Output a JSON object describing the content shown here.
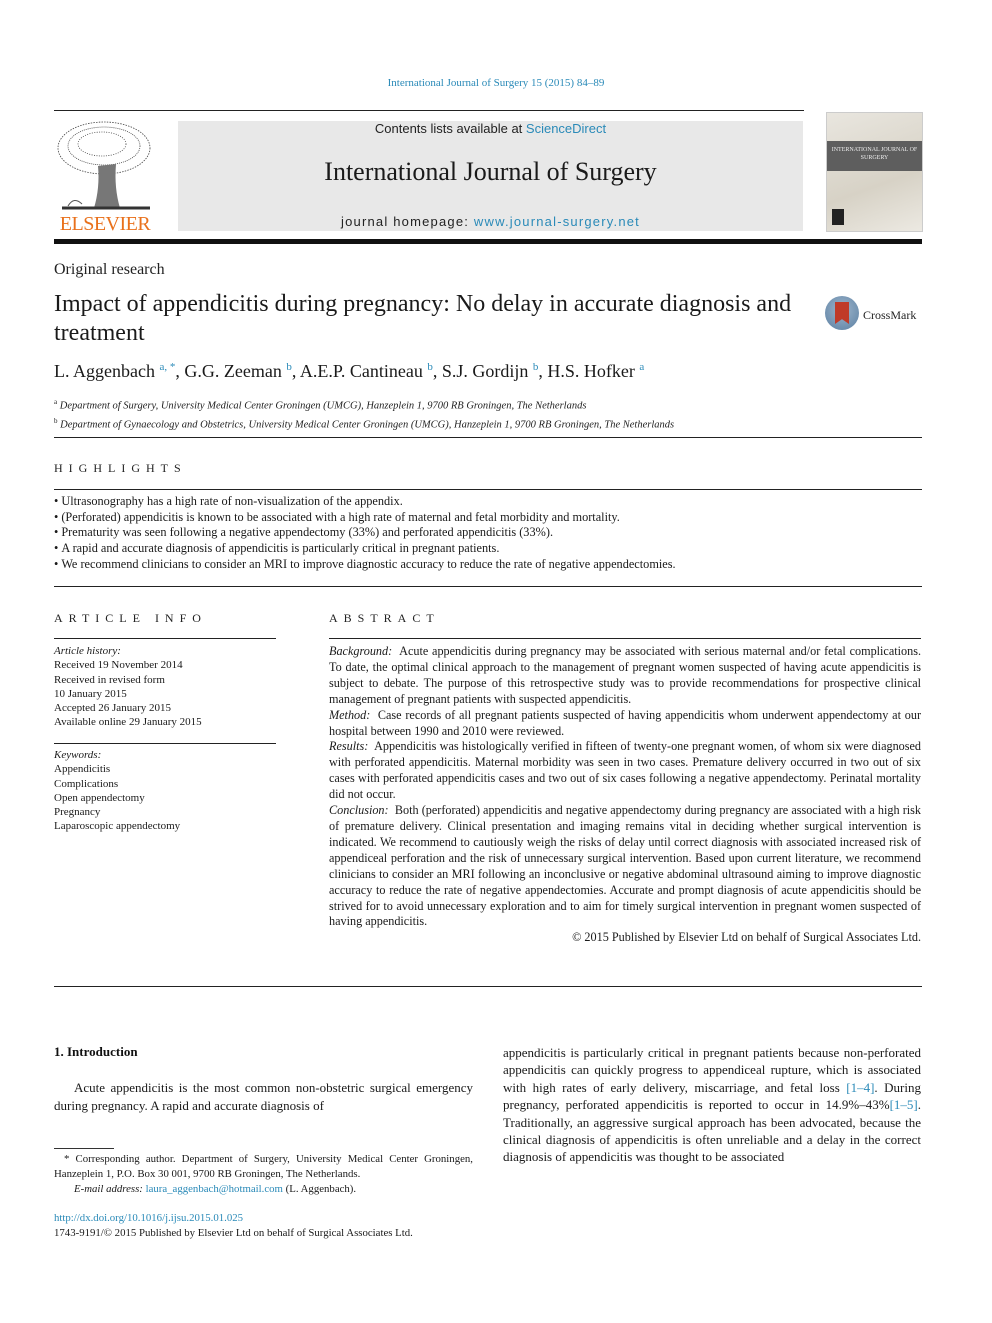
{
  "header": {
    "citation": "International Journal of Surgery 15 (2015) 84–89",
    "publisher_logo_text": "ELSEVIER",
    "contents_prefix": "Contents lists available at ",
    "contents_link": "ScienceDirect",
    "journal_title": "International Journal of Surgery",
    "homepage_prefix": "journal homepage: ",
    "homepage_link": "www.journal-surgery.net",
    "cover_title": "INTERNATIONAL JOURNAL OF SURGERY",
    "crossmark_label": "CrossMark"
  },
  "article": {
    "type": "Original research",
    "title": "Impact of appendicitis during pregnancy: No delay in accurate diagnosis and treatment",
    "authors": [
      {
        "name": "L. Aggenbach",
        "sup": "a, *"
      },
      {
        "name": "G.G. Zeeman",
        "sup": "b"
      },
      {
        "name": "A.E.P. Cantineau",
        "sup": "b"
      },
      {
        "name": "S.J. Gordijn",
        "sup": "b"
      },
      {
        "name": "H.S. Hofker",
        "sup": "a"
      }
    ],
    "affiliations": [
      {
        "key": "a",
        "text": "Department of Surgery, University Medical Center Groningen (UMCG), Hanzeplein 1, 9700 RB Groningen, The Netherlands"
      },
      {
        "key": "b",
        "text": "Department of Gynaecology and Obstetrics, University Medical Center Groningen (UMCG), Hanzeplein 1, 9700 RB Groningen, The Netherlands"
      }
    ]
  },
  "highlights": {
    "heading": "HIGHLIGHTS",
    "items": [
      "Ultrasonography has a high rate of non-visualization of the appendix.",
      "(Perforated) appendicitis is known to be associated with a high rate of maternal and fetal morbidity and mortality.",
      "Prematurity was seen following a negative appendectomy (33%) and perforated appendicitis (33%).",
      "A rapid and accurate diagnosis of appendicitis is particularly critical in pregnant patients.",
      "We recommend clinicians to consider an MRI to improve diagnostic accuracy to reduce the rate of negative appendectomies."
    ]
  },
  "article_info": {
    "heading": "ARTICLE INFO",
    "history_label": "Article history:",
    "history": [
      "Received 19 November 2014",
      "Received in revised form",
      "10 January 2015",
      "Accepted 26 January 2015",
      "Available online 29 January 2015"
    ],
    "keywords_label": "Keywords:",
    "keywords": [
      "Appendicitis",
      "Complications",
      "Open appendectomy",
      "Pregnancy",
      "Laparoscopic appendectomy"
    ]
  },
  "abstract": {
    "heading": "ABSTRACT",
    "sections": [
      {
        "label": "Background:",
        "text": "Acute appendicitis during pregnancy may be associated with serious maternal and/or fetal complications. To date, the optimal clinical approach to the management of pregnant women suspected of having acute appendicitis is subject to debate. The purpose of this retrospective study was to provide recommendations for prospective clinical management of pregnant patients with suspected appendicitis."
      },
      {
        "label": "Method:",
        "text": "Case records of all pregnant patients suspected of having appendicitis whom underwent ap­pendectomy at our hospital between 1990 and 2010 were reviewed."
      },
      {
        "label": "Results:",
        "text": "Appendicitis was histologically verified in fifteen of twenty-one pregnant women, of whom six were diagnosed with perforated appendicitis. Maternal morbidity was seen in two cases. Premature delivery occurred in two out of six cases with perforated appendicitis cases and two out of six cases following a negative appendectomy. Perinatal mortality did not occur."
      },
      {
        "label": "Conclusion:",
        "text": "Both (perforated) appendicitis and negative appendectomy during pregnancy are associated with a high risk of premature delivery. Clinical presentation and imaging remains vital in deciding whether surgical intervention is indicated. We recommend to cautiously weigh the risks of delay until correct diagnosis with associated increased risk of appendiceal perforation and the risk of unnecessary surgical intervention. Based upon current literature, we recommend clinicians to consider an MRI following an inconclusive or negative abdominal ultrasound aiming to improve diagnostic accuracy to reduce the rate of negative appendectomies. Accurate and prompt diagnosis of acute appendicitis should be strived for to avoid unnecessary exploration and to aim for timely surgical intervention in pregnant women suspected of having appendicitis."
      }
    ],
    "copyright": "© 2015 Published by Elsevier Ltd on behalf of Surgical Associates Ltd."
  },
  "body": {
    "intro_heading": "1.  Introduction",
    "intro_left": "Acute appendicitis is the most common non-obstetric surgical emergency during pregnancy. A rapid and accurate diagnosis of",
    "intro_right_1": "appendicitis is particularly critical in pregnant patients because non-perforated appendicitis can quickly progress to appendiceal rupture, which is associated with high rates of early delivery, miscarriage, and fetal loss ",
    "ref_1": "[1–4]",
    "intro_right_2": ". During pregnancy, perforated appendicitis is reported to occur in 14.9%–43%",
    "ref_2": "[1–5]",
    "intro_right_3": ". Traditionally, an aggressive surgical approach has been advocated, because the clinical diagnosis of appendicitis is often unreliable and a delay in the correct diagnosis of appendicitis was thought to be associated"
  },
  "footnote": {
    "corresponding": "* Corresponding author. Department of Surgery, University Medical Center Gro­ningen, Hanzeplein 1, P.O. Box 30 001, 9700 RB Groningen, The Netherlands.",
    "email_label": "E-mail address: ",
    "email": "laura_aggenbach@hotmail.com",
    "email_suffix": " (L. Aggenbach).",
    "doi": "http://dx.doi.org/10.1016/j.ijsu.2015.01.025",
    "issn_line": "1743-9191/© 2015 Published by Elsevier Ltd on behalf of Surgical Associates Ltd."
  }
}
